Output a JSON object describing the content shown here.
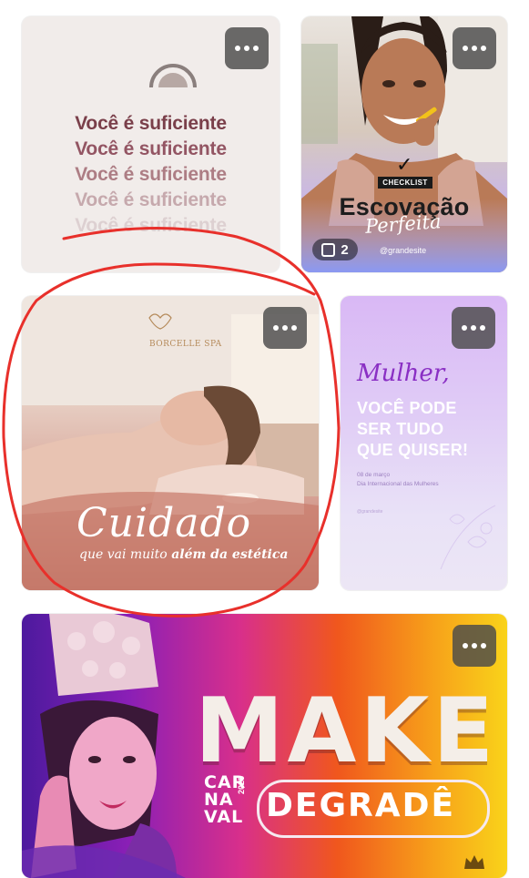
{
  "menu": {
    "more_label": "more options"
  },
  "cards": [
    {
      "lines": [
        "Você é suficiente",
        "Você é suficiente",
        "Você é suficiente",
        "Você é suficiente",
        "Você é suficiente"
      ],
      "line_colors": [
        "#7a3f4a",
        "#935563",
        "#ad7d84",
        "#c6a9ad",
        "#ddd0d1"
      ]
    },
    {
      "badge": "CHECKLIST",
      "title": "Escovação",
      "script": "Perfeita",
      "handle": "@grandesite",
      "count": "2"
    },
    {
      "brand": "BORCELLE SPA",
      "script": "Cuidado",
      "subtitle_prefix": "que vai muito",
      "subtitle_emphasis": "além da estética"
    },
    {
      "script": "Mulher,",
      "lines": [
        "VOCÊ PODE",
        "SER TUDO",
        "QUE QUISER!"
      ],
      "date": "08 de março",
      "event": "Dia Internacional das Mulheres",
      "handle": "@grandesite"
    },
    {
      "title": "MAKE",
      "side": [
        "CAR",
        "NA",
        "VAL"
      ],
      "year": "2025",
      "subtitle": "DEGRADÊ"
    }
  ]
}
